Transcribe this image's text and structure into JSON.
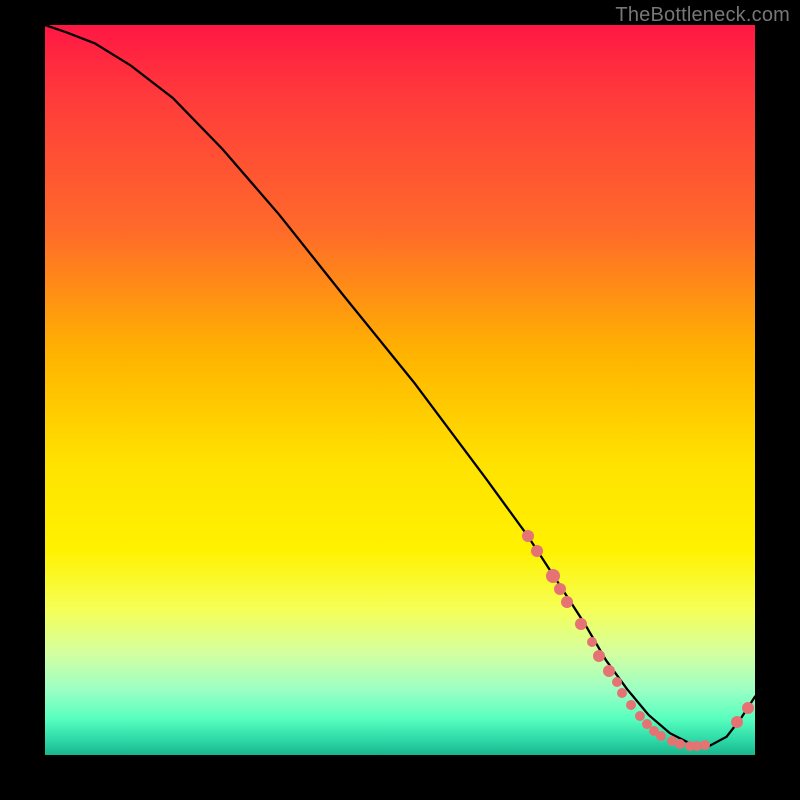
{
  "attribution": "TheBottleneck.com",
  "chart_data": {
    "type": "line",
    "title": "",
    "xlabel": "",
    "ylabel": "",
    "xlim": [
      0,
      100
    ],
    "ylim": [
      0,
      100
    ],
    "series": [
      {
        "name": "curve",
        "x": [
          0,
          3,
          7,
          12,
          18,
          25,
          33,
          42,
          52,
          62,
          68,
          72,
          76,
          79,
          82,
          85,
          88,
          91,
          93.5,
          96,
          98,
          100
        ],
        "y": [
          100,
          99,
          97.5,
          94.5,
          90,
          83,
          74,
          63,
          51,
          38,
          30,
          24,
          18,
          13,
          9,
          5.5,
          3,
          1.5,
          1.2,
          2.5,
          5,
          8
        ]
      }
    ],
    "points": [
      {
        "x": 68.0,
        "y": 30.0,
        "r": 6
      },
      {
        "x": 69.3,
        "y": 28.0,
        "r": 6
      },
      {
        "x": 71.5,
        "y": 24.5,
        "r": 7
      },
      {
        "x": 72.5,
        "y": 22.8,
        "r": 6
      },
      {
        "x": 73.5,
        "y": 21.0,
        "r": 6
      },
      {
        "x": 75.5,
        "y": 18.0,
        "r": 6
      },
      {
        "x": 77.0,
        "y": 15.5,
        "r": 5
      },
      {
        "x": 78.0,
        "y": 13.5,
        "r": 6
      },
      {
        "x": 79.5,
        "y": 11.5,
        "r": 6
      },
      {
        "x": 80.5,
        "y": 10.0,
        "r": 5
      },
      {
        "x": 81.3,
        "y": 8.5,
        "r": 5
      },
      {
        "x": 82.5,
        "y": 6.8,
        "r": 5
      },
      {
        "x": 83.8,
        "y": 5.3,
        "r": 5
      },
      {
        "x": 84.8,
        "y": 4.2,
        "r": 5
      },
      {
        "x": 85.8,
        "y": 3.3,
        "r": 5
      },
      {
        "x": 86.8,
        "y": 2.6,
        "r": 5
      },
      {
        "x": 88.3,
        "y": 1.9,
        "r": 5
      },
      {
        "x": 89.4,
        "y": 1.5,
        "r": 5
      },
      {
        "x": 90.8,
        "y": 1.3,
        "r": 5
      },
      {
        "x": 91.9,
        "y": 1.3,
        "r": 5
      },
      {
        "x": 93.0,
        "y": 1.4,
        "r": 5
      },
      {
        "x": 97.5,
        "y": 4.5,
        "r": 6
      },
      {
        "x": 99.0,
        "y": 6.5,
        "r": 6
      }
    ]
  }
}
